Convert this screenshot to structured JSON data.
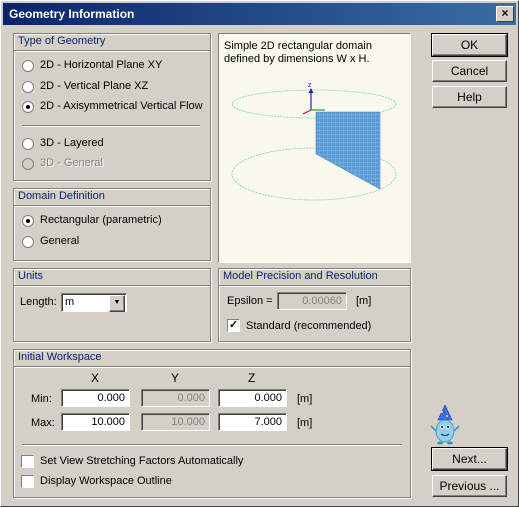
{
  "window": {
    "title": "Geometry Information",
    "close_glyph": "×"
  },
  "type_of_geometry": {
    "heading": "Type of Geometry",
    "options": [
      {
        "label": "2D - Horizontal Plane XY",
        "selected": false,
        "enabled": true
      },
      {
        "label": "2D - Vertical Plane XZ",
        "selected": false,
        "enabled": true
      },
      {
        "label": "2D - Axisymmetrical Vertical Flow",
        "selected": true,
        "enabled": true
      },
      {
        "label": "3D - Layered",
        "selected": false,
        "enabled": true
      },
      {
        "label": "3D - General",
        "selected": false,
        "enabled": false
      }
    ]
  },
  "preview": {
    "description": "Simple 2D rectangular domain defined by dimensions W x H.",
    "axis_label": "z"
  },
  "domain_definition": {
    "heading": "Domain Definition",
    "options": [
      {
        "label": "Rectangular (parametric)",
        "selected": true
      },
      {
        "label": "General",
        "selected": false
      }
    ]
  },
  "units": {
    "heading": "Units",
    "length_label": "Length:",
    "length_value": "m",
    "dropdown_glyph": "▼"
  },
  "precision": {
    "heading": "Model Precision and Resolution",
    "epsilon_label": "Epsilon =",
    "epsilon_value": "0.00060",
    "epsilon_unit": "[m]",
    "standard_label": "Standard (recommended)",
    "standard_checked": true,
    "check_glyph": "✓"
  },
  "workspace": {
    "heading": "Initial Workspace",
    "columns": [
      "X",
      "Y",
      "Z"
    ],
    "min_label": "Min:",
    "max_label": "Max:",
    "min": {
      "x": "0.000",
      "y": "0.000",
      "z": "0.000"
    },
    "max": {
      "x": "10.000",
      "y": "10.000",
      "z": "7.000"
    },
    "unit_min": "[m]",
    "unit_max": "[m]",
    "stretch_label": "Set View Stretching Factors Automatically",
    "outline_label": "Display Workspace Outline"
  },
  "buttons": {
    "ok": "OK",
    "cancel": "Cancel",
    "help": "Help",
    "next": "Next...",
    "previous": "Previous ..."
  },
  "colors": {
    "title_start": "#0a246a",
    "title_end": "#3a6ea5",
    "group_heading": "#0a246a",
    "face": "#d4d0c8",
    "mesh": "#5b9bd5"
  }
}
